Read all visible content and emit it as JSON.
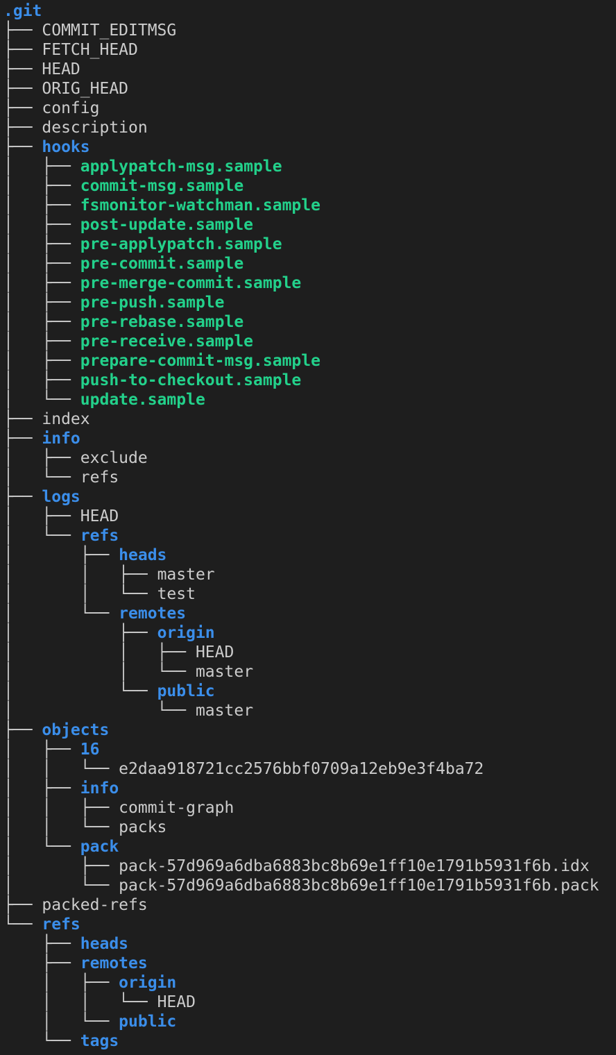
{
  "colors": {
    "background": "#1e1e1e",
    "file": "#cccccc",
    "directory": "#3b8eea",
    "executable": "#23d18b"
  },
  "tree": {
    "name": ".git",
    "type": "dir",
    "children": [
      {
        "name": "COMMIT_EDITMSG",
        "type": "file"
      },
      {
        "name": "FETCH_HEAD",
        "type": "file"
      },
      {
        "name": "HEAD",
        "type": "file"
      },
      {
        "name": "ORIG_HEAD",
        "type": "file"
      },
      {
        "name": "config",
        "type": "file"
      },
      {
        "name": "description",
        "type": "file"
      },
      {
        "name": "hooks",
        "type": "dir",
        "children": [
          {
            "name": "applypatch-msg.sample",
            "type": "exec"
          },
          {
            "name": "commit-msg.sample",
            "type": "exec"
          },
          {
            "name": "fsmonitor-watchman.sample",
            "type": "exec"
          },
          {
            "name": "post-update.sample",
            "type": "exec"
          },
          {
            "name": "pre-applypatch.sample",
            "type": "exec"
          },
          {
            "name": "pre-commit.sample",
            "type": "exec"
          },
          {
            "name": "pre-merge-commit.sample",
            "type": "exec"
          },
          {
            "name": "pre-push.sample",
            "type": "exec"
          },
          {
            "name": "pre-rebase.sample",
            "type": "exec"
          },
          {
            "name": "pre-receive.sample",
            "type": "exec"
          },
          {
            "name": "prepare-commit-msg.sample",
            "type": "exec"
          },
          {
            "name": "push-to-checkout.sample",
            "type": "exec"
          },
          {
            "name": "update.sample",
            "type": "exec"
          }
        ]
      },
      {
        "name": "index",
        "type": "file"
      },
      {
        "name": "info",
        "type": "dir",
        "children": [
          {
            "name": "exclude",
            "type": "file"
          },
          {
            "name": "refs",
            "type": "file"
          }
        ]
      },
      {
        "name": "logs",
        "type": "dir",
        "children": [
          {
            "name": "HEAD",
            "type": "file"
          },
          {
            "name": "refs",
            "type": "dir",
            "children": [
              {
                "name": "heads",
                "type": "dir",
                "children": [
                  {
                    "name": "master",
                    "type": "file"
                  },
                  {
                    "name": "test",
                    "type": "file"
                  }
                ]
              },
              {
                "name": "remotes",
                "type": "dir",
                "children": [
                  {
                    "name": "origin",
                    "type": "dir",
                    "children": [
                      {
                        "name": "HEAD",
                        "type": "file"
                      },
                      {
                        "name": "master",
                        "type": "file"
                      }
                    ]
                  },
                  {
                    "name": "public",
                    "type": "dir",
                    "children": [
                      {
                        "name": "master",
                        "type": "file"
                      }
                    ]
                  }
                ]
              }
            ]
          }
        ]
      },
      {
        "name": "objects",
        "type": "dir",
        "children": [
          {
            "name": "16",
            "type": "dir",
            "children": [
              {
                "name": "e2daa918721cc2576bbf0709a12eb9e3f4ba72",
                "type": "file"
              }
            ]
          },
          {
            "name": "info",
            "type": "dir",
            "children": [
              {
                "name": "commit-graph",
                "type": "file"
              },
              {
                "name": "packs",
                "type": "file"
              }
            ]
          },
          {
            "name": "pack",
            "type": "dir",
            "children": [
              {
                "name": "pack-57d969a6dba6883bc8b69e1ff10e1791b5931f6b.idx",
                "type": "file"
              },
              {
                "name": "pack-57d969a6dba6883bc8b69e1ff10e1791b5931f6b.pack",
                "type": "file"
              }
            ]
          }
        ]
      },
      {
        "name": "packed-refs",
        "type": "file"
      },
      {
        "name": "refs",
        "type": "dir",
        "children": [
          {
            "name": "heads",
            "type": "dir",
            "children": []
          },
          {
            "name": "remotes",
            "type": "dir",
            "children": [
              {
                "name": "origin",
                "type": "dir",
                "children": [
                  {
                    "name": "HEAD",
                    "type": "file"
                  }
                ]
              },
              {
                "name": "public",
                "type": "dir",
                "children": []
              }
            ]
          },
          {
            "name": "tags",
            "type": "dir",
            "children": []
          }
        ]
      }
    ]
  }
}
